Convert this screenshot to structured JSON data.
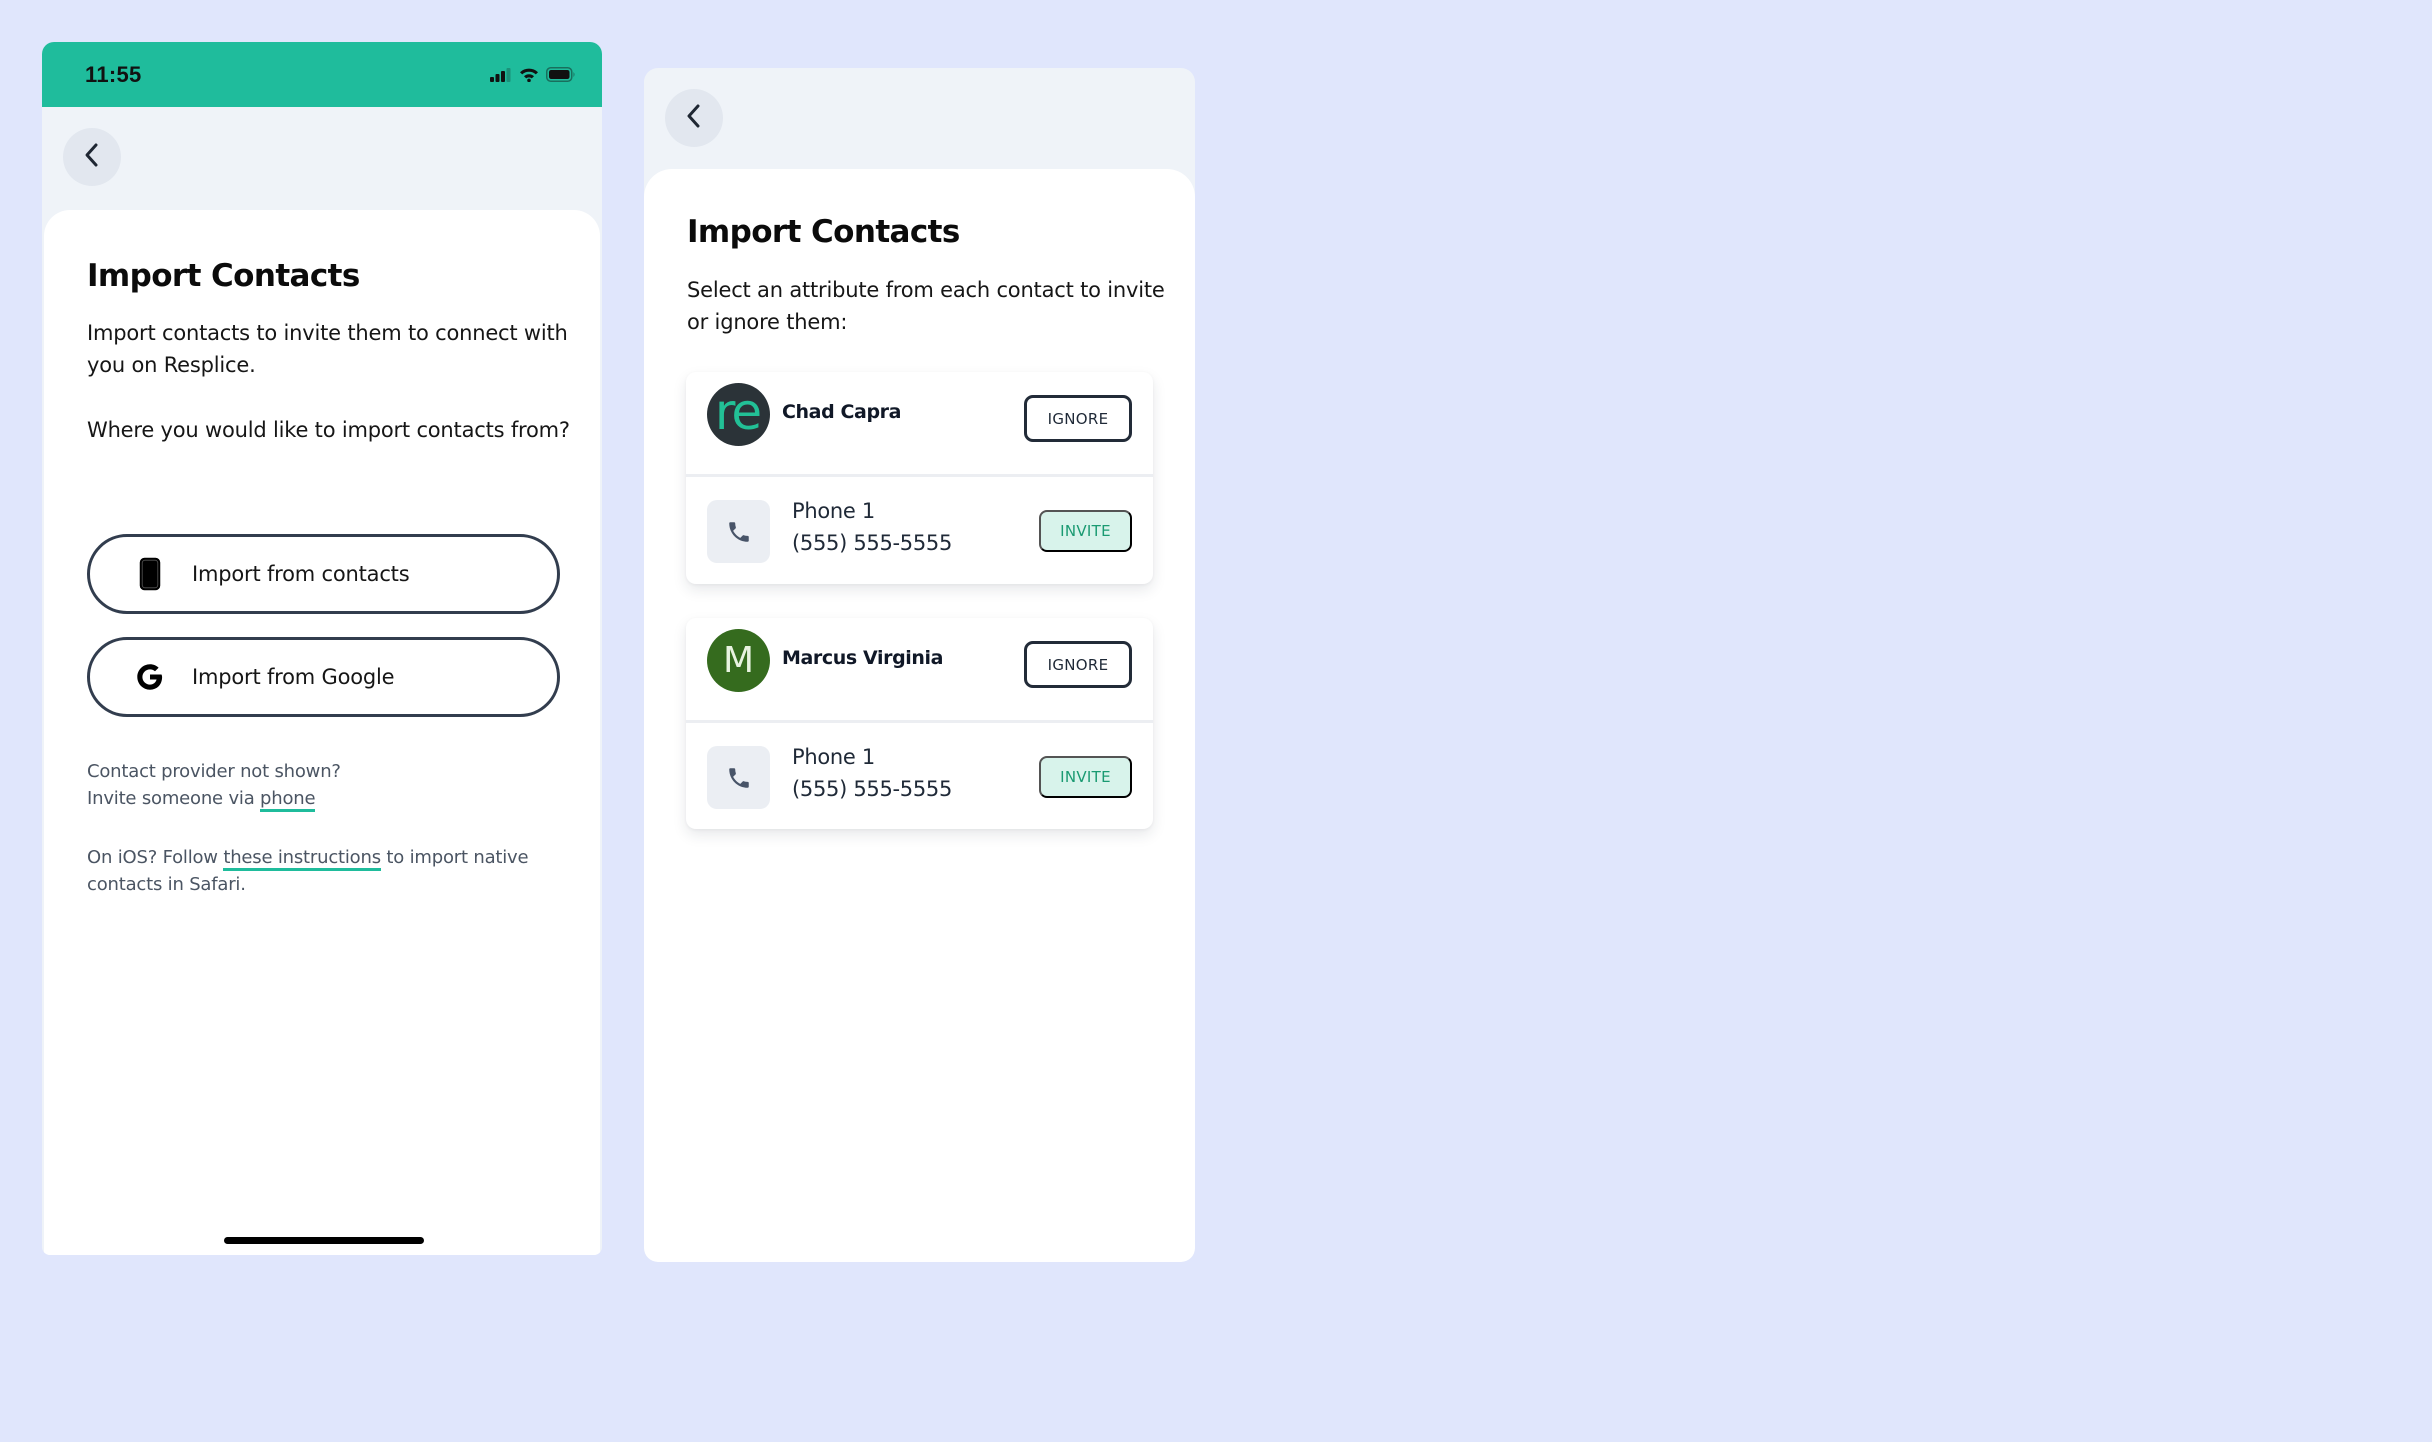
{
  "colors": {
    "background": "#e0e6fc",
    "status_bar": "#1fbc9c",
    "accent": "#1fbc9c",
    "invite_bg": "#d8f3eb",
    "invite_text": "#1a9a72",
    "header_bg": "#eff3f8"
  },
  "screen1": {
    "status_bar": {
      "time": "11:55",
      "icons": [
        "signal-icon",
        "wifi-icon",
        "battery-icon"
      ]
    },
    "back_icon": "chevron-left-icon",
    "title": "Import Contacts",
    "intro": "Import contacts to invite them to connect with you on Resplice.",
    "question": "Where you would like to import contacts from?",
    "buttons": [
      {
        "icon": "smartphone-icon",
        "label": "Import from contacts"
      },
      {
        "icon": "google-icon",
        "label": "Import from Google"
      }
    ],
    "provider_note": {
      "line1": "Contact provider not shown?",
      "line2_prefix": "Invite someone via ",
      "link": "phone"
    },
    "ios_note": {
      "prefix": "On iOS? Follow ",
      "link": "these instructions",
      "suffix": " to import native contacts in Safari."
    }
  },
  "screen2": {
    "back_icon": "chevron-left-icon",
    "title": "Import Contacts",
    "intro": "Select an attribute from each contact to invite or ignore them:",
    "contacts": [
      {
        "name": "Chad Capra",
        "avatar": {
          "type": "logo",
          "text": "re"
        },
        "ignore_label": "IGNORE",
        "attributes": [
          {
            "icon": "phone-icon",
            "label": "Phone 1",
            "value": "(555) 555-5555",
            "action": "INVITE"
          }
        ]
      },
      {
        "name": "Marcus Virginia",
        "avatar": {
          "type": "initial",
          "text": "M"
        },
        "ignore_label": "IGNORE",
        "attributes": [
          {
            "icon": "phone-icon",
            "label": "Phone 1",
            "value": "(555) 555-5555",
            "action": "INVITE"
          }
        ]
      }
    ]
  }
}
